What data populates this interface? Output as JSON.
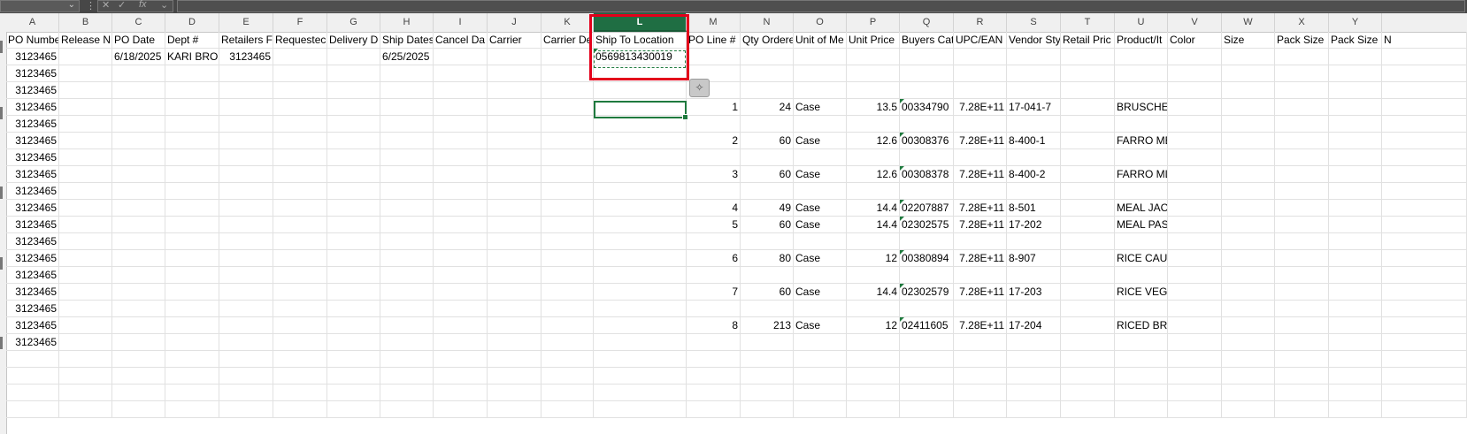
{
  "toolbar": {
    "namebox_value": "",
    "more_symbol": "⋮",
    "cancel_symbol": "✕",
    "enter_symbol": "✓",
    "fx_label": "fx",
    "formula_value": ""
  },
  "columns": [
    "A",
    "B",
    "C",
    "D",
    "E",
    "F",
    "G",
    "H",
    "I",
    "J",
    "K",
    "L",
    "M",
    "N",
    "O",
    "P",
    "Q",
    "R",
    "S",
    "T",
    "U",
    "V",
    "W",
    "X",
    "Y"
  ],
  "selected_column": "L",
  "headers": [
    "PO Numbe",
    "Release N",
    "PO Date",
    "Dept #",
    "Retailers F",
    "Requestec",
    "Delivery D",
    "Ship Dates",
    "Cancel Da",
    "Carrier",
    "Carrier De",
    "Ship To Location",
    "PO Line #",
    "Qty Ordere",
    "Unit of Me",
    "Unit Price",
    "Buyers Cat",
    "UPC/EAN",
    "Vendor Sty",
    "Retail Pric",
    "Product/It",
    "Color",
    "Size",
    "Pack Size",
    "Pack Size",
    "N"
  ],
  "rows": [
    {
      "A": "3123465",
      "C": "6/18/2025",
      "D": "KARI BROC",
      "E": "3123465",
      "H": "6/25/2025",
      "L": "0569813430019"
    },
    {
      "A": "3123465"
    },
    {
      "A": "3123465"
    },
    {
      "A": "3123465",
      "M": "1",
      "N": "24",
      "O": "Case",
      "P": "13.5",
      "Q": "00334790",
      "R": "7.28E+11",
      "S": "17-041-7",
      "U": "BRUSCHETTA SNDRIED TOMATO"
    },
    {
      "A": "3123465"
    },
    {
      "A": "3123465",
      "M": "2",
      "N": "60",
      "O": "Case",
      "P": "12.6",
      "Q": "00308376",
      "R": "7.28E+11",
      "S": "8-400-1",
      "U": "FARRO MEAL GRLD VEG  HERB"
    },
    {
      "A": "3123465"
    },
    {
      "A": "3123465",
      "M": "3",
      "N": "60",
      "O": "Case",
      "P": "12.6",
      "Q": "00308378",
      "R": "7.28E+11",
      "S": "8-400-2",
      "U": "FARRO ML ARTKE LMN RST GC"
    },
    {
      "A": "3123465"
    },
    {
      "A": "3123465",
      "M": "4",
      "N": "49",
      "O": "Case",
      "P": "14.4",
      "Q": "02207887",
      "R": "7.28E+11",
      "S": "8-501",
      "U": "MEAL JACKFRT SWT BBQ PRK"
    },
    {
      "A": "3123465",
      "M": "5",
      "N": "60",
      "O": "Case",
      "P": "14.4",
      "Q": "02302575",
      "R": "7.28E+11",
      "S": "17-202",
      "U": "MEAL PASTA PRIMAVERA HOP"
    },
    {
      "A": "3123465"
    },
    {
      "A": "3123465",
      "M": "6",
      "N": "80",
      "O": "Case",
      "P": "12",
      "Q": "00380894",
      "R": "7.28E+11",
      "S": "8-907",
      "U": "RICE CAULIFLOWER RTH"
    },
    {
      "A": "3123465"
    },
    {
      "A": "3123465",
      "M": "7",
      "N": "60",
      "O": "Case",
      "P": "14.4",
      "Q": "02302579",
      "R": "7.28E+11",
      "S": "17-203",
      "U": "RICE VEGGIE HOP STIR FRY"
    },
    {
      "A": "3123465"
    },
    {
      "A": "3123465",
      "M": "8",
      "N": "213",
      "O": "Case",
      "P": "12",
      "Q": "02411605",
      "R": "7.28E+11",
      "S": "17-204",
      "U": "RICED BROCCOLI RTH"
    },
    {
      "A": "3123465"
    },
    {},
    {},
    {},
    {}
  ],
  "paste_options_icon": "paste-options-icon",
  "colors": {
    "accent": "#1f7a3e",
    "selected_header": "#1f6e43",
    "highlight_box": "#e3001b",
    "toolbar": "#474747"
  }
}
